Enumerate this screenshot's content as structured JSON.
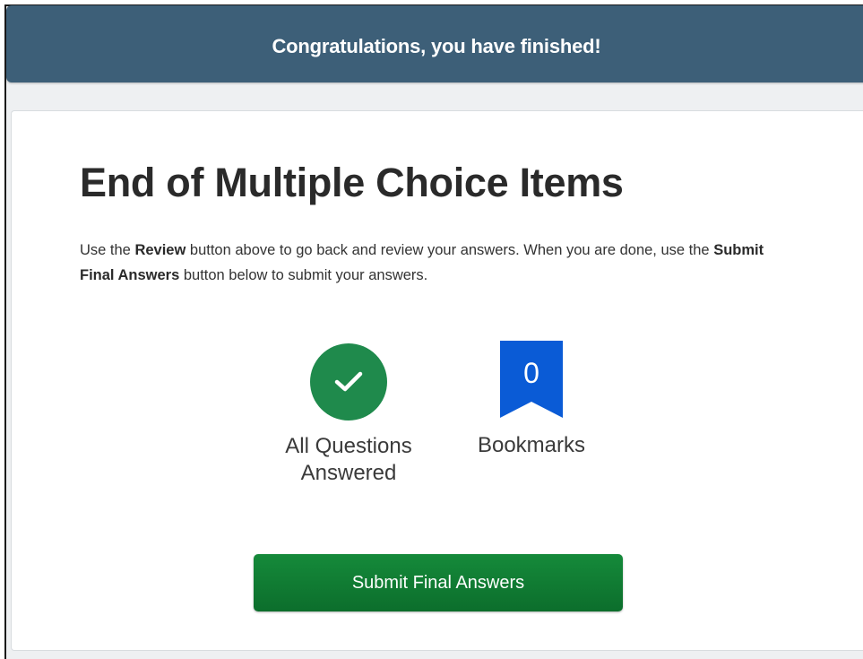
{
  "banner": {
    "text": "Congratulations, you have finished!"
  },
  "main": {
    "title": "End of Multiple Choice Items",
    "instructions": {
      "part1": "Use the ",
      "review_bold": "Review",
      "part2": " button above to go back and review your answers. When you are done, use the ",
      "submit_bold": "Submit Final Answers",
      "part3": " button below to submit your answers."
    }
  },
  "stats": {
    "answered": {
      "icon": "checkmark-icon",
      "label": "All Questions Answered",
      "color": "#1f8a4c"
    },
    "bookmarks": {
      "icon": "bookmark-icon",
      "count": "0",
      "label": "Bookmarks",
      "color": "#0a5bd6"
    }
  },
  "actions": {
    "submit_label": "Submit Final Answers",
    "submit_color": "#158a3a"
  },
  "colors": {
    "banner": "#3d5f78",
    "text": "#2a2a2a"
  }
}
